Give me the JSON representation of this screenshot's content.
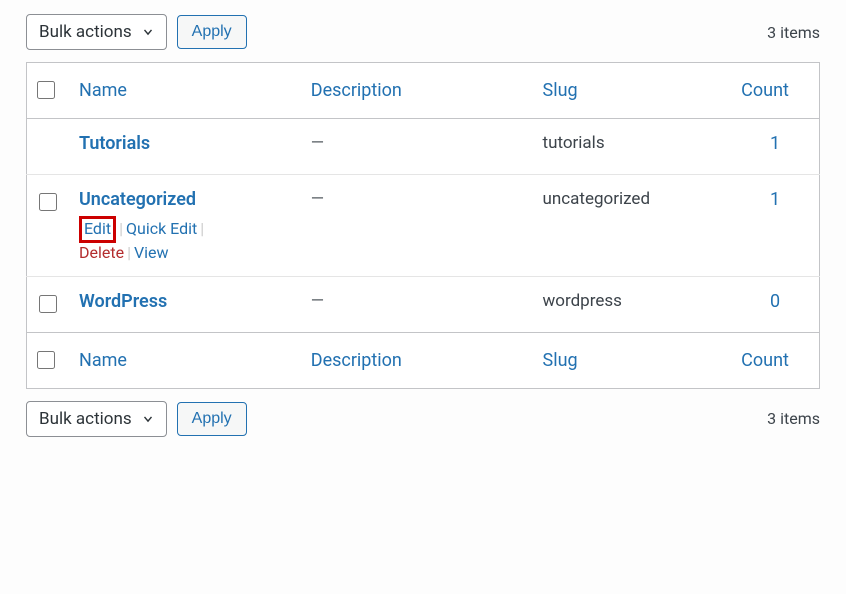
{
  "bulkActions": {
    "label": "Bulk actions",
    "applyLabel": "Apply"
  },
  "itemsCount": "3 items",
  "columns": {
    "name": "Name",
    "description": "Description",
    "slug": "Slug",
    "count": "Count"
  },
  "rows": [
    {
      "name": "Tutorials",
      "description": "—",
      "slug": "tutorials",
      "count": "1",
      "hasCheckbox": false,
      "showActions": false
    },
    {
      "name": "Uncategorized",
      "description": "—",
      "slug": "uncategorized",
      "count": "1",
      "hasCheckbox": true,
      "showActions": true
    },
    {
      "name": "WordPress",
      "description": "—",
      "slug": "wordpress",
      "count": "0",
      "hasCheckbox": true,
      "showActions": false
    }
  ],
  "rowActions": {
    "edit": "Edit",
    "quickEdit": "Quick Edit",
    "delete": "Delete",
    "view": "View"
  }
}
